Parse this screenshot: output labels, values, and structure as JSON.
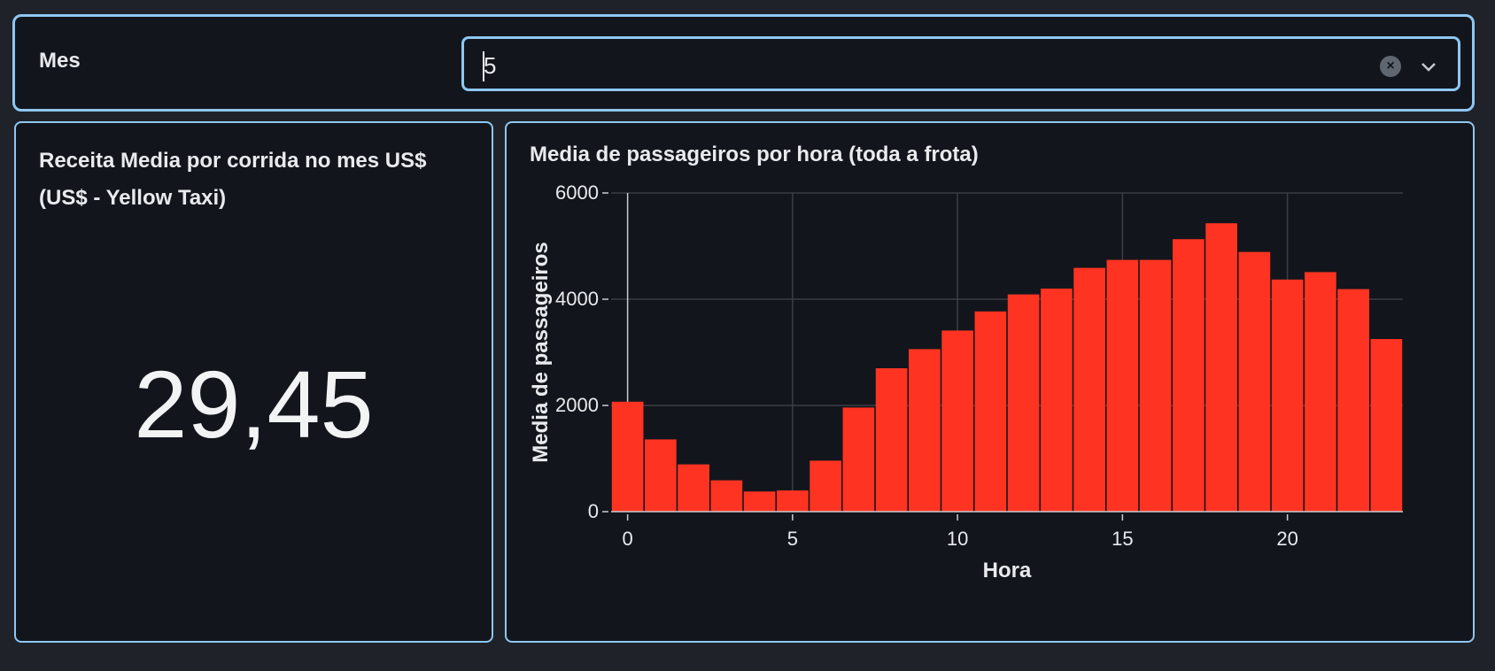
{
  "filter": {
    "label": "Mes",
    "selected_value": "5",
    "clear_icon": "clear-icon",
    "dropdown_icon": "chevron-down-icon"
  },
  "kpi": {
    "title": "Receita Media por corrida no mes US$ (US$ - Yellow Taxi)",
    "value": "29,45"
  },
  "chart_title": "Media de passageiros por hora (toda a frota)",
  "colors": {
    "bar": "#ff3322",
    "panel_border": "#8ec7f3",
    "background": "#12161c",
    "grid": "#3a3f45"
  },
  "chart_data": {
    "type": "bar",
    "title": "Media de passageiros por hora (toda a frota)",
    "xlabel": "Hora",
    "ylabel": "Media de passageiros",
    "x": [
      0,
      1,
      2,
      3,
      4,
      5,
      6,
      7,
      8,
      9,
      10,
      11,
      12,
      13,
      14,
      15,
      16,
      17,
      18,
      19,
      20,
      21,
      22,
      23
    ],
    "values": [
      2070,
      1360,
      890,
      590,
      380,
      400,
      960,
      1960,
      2700,
      3060,
      3410,
      3770,
      4090,
      4200,
      4590,
      4740,
      4740,
      5130,
      5430,
      4890,
      4370,
      4510,
      4190,
      3250
    ],
    "xlim": [
      -0.5,
      23.5
    ],
    "ylim": [
      0,
      6000
    ],
    "x_ticks": [
      0,
      5,
      10,
      15,
      20
    ],
    "y_ticks": [
      0,
      2000,
      4000,
      6000
    ],
    "grid": true
  }
}
